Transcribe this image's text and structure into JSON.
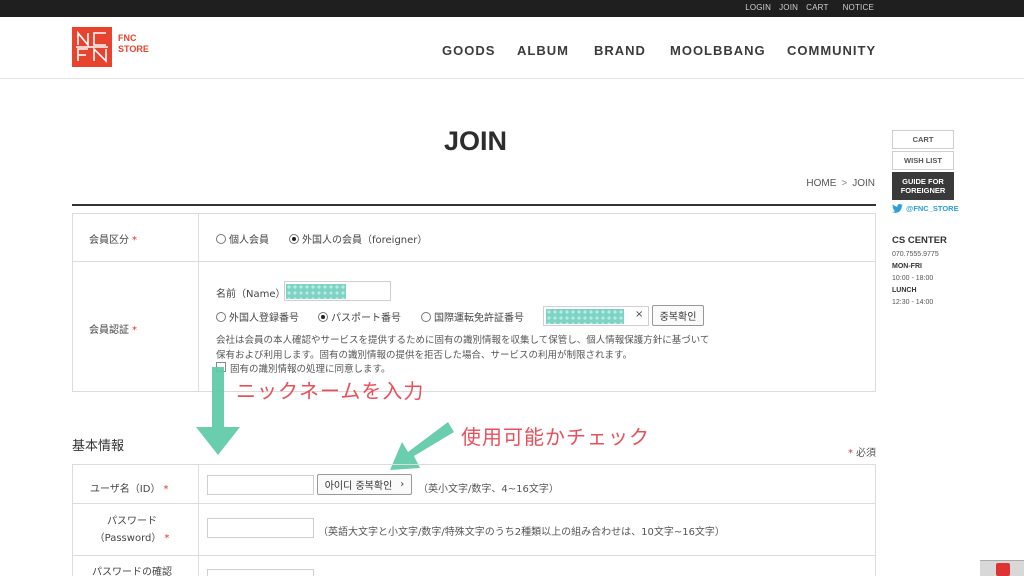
{
  "topbar": {
    "links": [
      "LOGIN",
      "JOIN",
      "CART",
      "NOTICE"
    ]
  },
  "header": {
    "logo_line1": "FNC",
    "logo_line2": "STORE",
    "nav": [
      "GOODS",
      "ALBUM",
      "BRAND",
      "MOOLBBANG",
      "COMMUNITY"
    ]
  },
  "page": {
    "title": "JOIN",
    "breadcrumb_home": "HOME",
    "breadcrumb_sep": ">",
    "breadcrumb_current": "JOIN"
  },
  "member_type": {
    "label": "会員区分",
    "star": "*",
    "opt_individual": "個人会員",
    "opt_foreigner": "外国人の会員（foreigner）",
    "selected": "foreigner"
  },
  "verification": {
    "label": "会員認証",
    "star": "*",
    "name_label": "名前（Name）",
    "opt_alien": "外国人登録番号",
    "opt_passport": "パスポート番号",
    "opt_license": "国際運転免許証番号",
    "clear_symbol": "×",
    "check_button": "중복확인",
    "notice_line1": "会社は会員の本人確認やサービスを提供するために固有の識別情報を収集して保管し、個人情報保護方針に基づいて",
    "notice_line2": "保有および利用します。固有の識別情報の提供を拒否した場合、サービスの利用が制限されます。",
    "consent": "固有の識別情報の処理に同意します。"
  },
  "annotations": {
    "nickname": "ニックネームを入力",
    "availability": "使用可能かチェック",
    "color": "#e8505b",
    "arrow_color": "#5cc9a7"
  },
  "basic_info": {
    "title": "基本情報",
    "required_star": "*",
    "required_label": "必須",
    "id_label": "ユーザ名（ID）",
    "id_star": "*",
    "id_check_button": "아이디 중복확인",
    "id_check_arrow": "›",
    "id_hint": "（英小文字/数字、4~16文字）",
    "pw_label_line1": "パスワード",
    "pw_label_line2": "（Password）",
    "pw_star": "*",
    "pw_hint": "（英語大文字と小文字/数字/特殊文字のうち2種類以上の組み合わせは、10文字~16文字）",
    "pw_confirm_label": "パスワードの確認"
  },
  "sidebar": {
    "cart": "CART",
    "wishlist": "WISH LIST",
    "guide_line1": "GUIDE FOR",
    "guide_line2": "FOREIGNER",
    "twitter": "@FNC_STORE",
    "cs_title": "CS CENTER",
    "cs_phone": "070.7555.9775",
    "cs_monfri": "MON-FRI",
    "cs_monfri_hours": "10:00 - 18:00",
    "cs_lunch": "LUNCH",
    "cs_lunch_hours": "12:30 - 14:00"
  },
  "colors": {
    "brand": "#e8432e",
    "topbar": "#1f1f1f",
    "twitter": "#2a9fd8",
    "required": "#dd3333"
  }
}
